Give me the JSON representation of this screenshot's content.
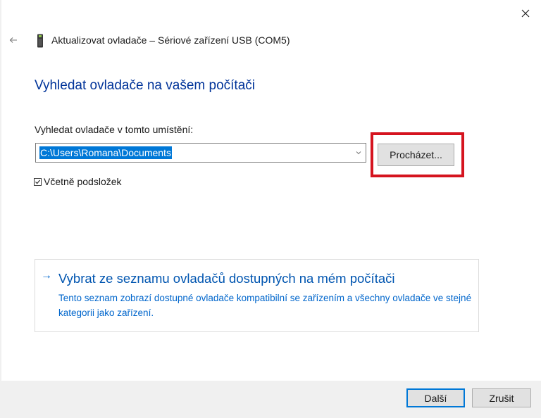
{
  "window": {
    "title": "Aktualizovat ovladače – Sériové zařízení USB (COM5)",
    "close_icon": "close-icon",
    "back_icon": "back-arrow-icon",
    "device_icon": "usb-device-icon"
  },
  "main": {
    "heading": "Vyhledat ovladače na vašem počítači",
    "location_label": "Vyhledat ovladače v tomto umístění:",
    "path_value": "C:\\Users\\Romana\\Documents",
    "browse_label": "Procházet...",
    "include_subfolders_label": "Včetně podsložek",
    "include_subfolders_checked": true
  },
  "pick_from_list": {
    "arrow": "→",
    "title": "Vybrat ze seznamu ovladačů dostupných na mém počítači",
    "description": "Tento seznam zobrazí dostupné ovladače kompatibilní se zařízením a všechny ovladače ve stejné kategorii jako zařízení."
  },
  "footer": {
    "next_label": "Další",
    "cancel_label": "Zrušit"
  },
  "colors": {
    "accent": "#0078d7",
    "heading": "#003399",
    "link": "#0066cc",
    "highlight": "#d5141f"
  }
}
